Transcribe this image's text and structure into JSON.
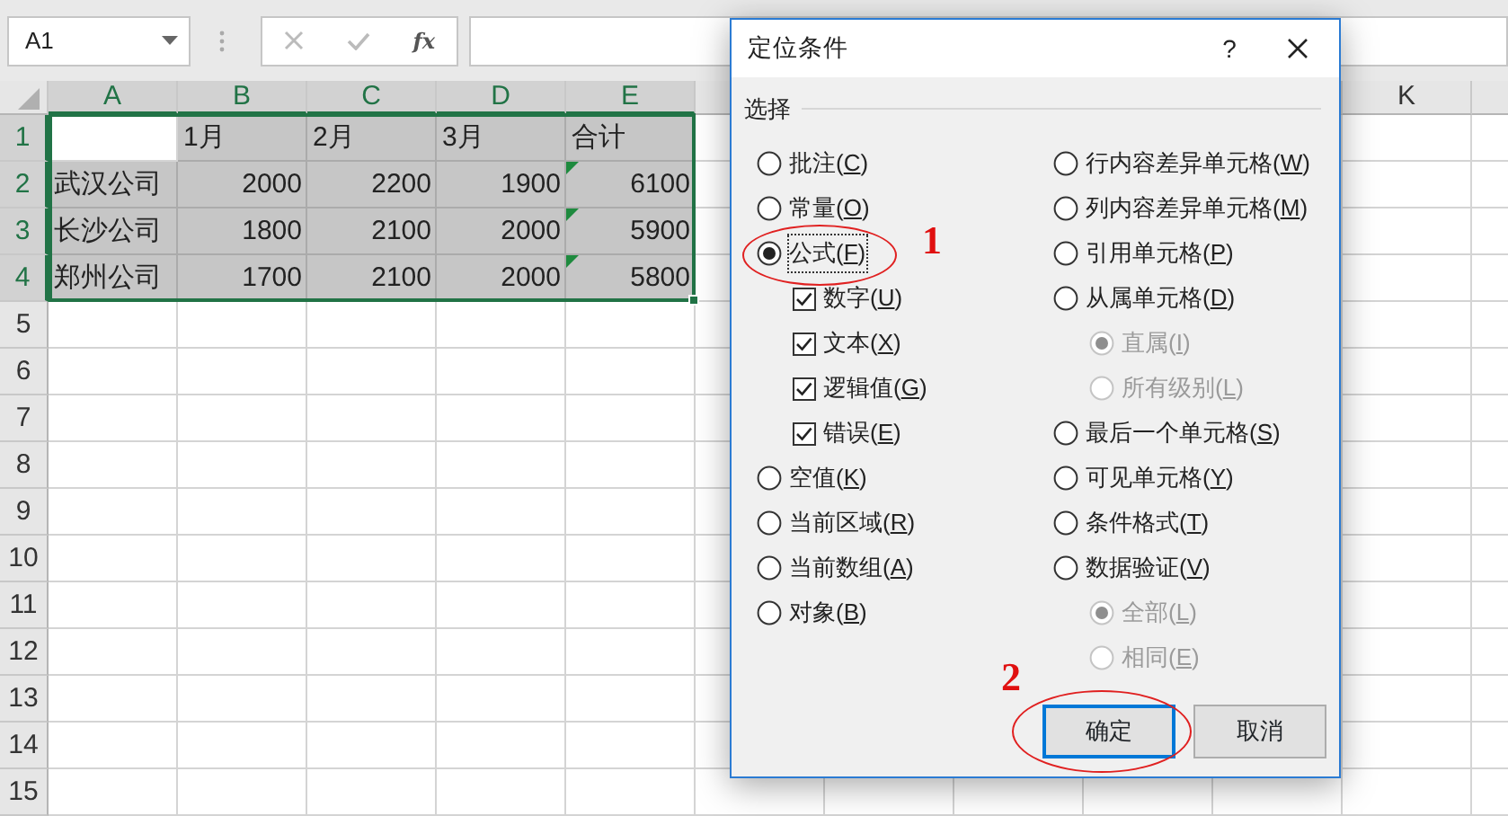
{
  "name_box": {
    "value": "A1"
  },
  "formula_bar": {
    "function_label": "fx"
  },
  "sheet": {
    "columns": [
      {
        "label": "A",
        "selected": true
      },
      {
        "label": "B",
        "selected": true
      },
      {
        "label": "C",
        "selected": true
      },
      {
        "label": "D",
        "selected": true
      },
      {
        "label": "E",
        "selected": true
      }
    ],
    "right_columns": [
      {
        "label": "K",
        "selected": false
      }
    ],
    "rows": [
      {
        "header": "1",
        "selected": true,
        "cells": [
          {
            "text": "",
            "selected": false
          },
          {
            "text": "1月",
            "selected": true
          },
          {
            "text": "2月",
            "selected": true
          },
          {
            "text": "3月",
            "selected": true
          },
          {
            "text": "合计",
            "selected": true
          }
        ]
      },
      {
        "header": "2",
        "selected": true,
        "cells": [
          {
            "text": "武汉公司",
            "selected": true
          },
          {
            "text": "2000",
            "selected": true
          },
          {
            "text": "2200",
            "selected": true
          },
          {
            "text": "1900",
            "selected": true
          },
          {
            "text": "6100",
            "selected": true,
            "flag": true
          }
        ]
      },
      {
        "header": "3",
        "selected": true,
        "cells": [
          {
            "text": "长沙公司",
            "selected": true
          },
          {
            "text": "1800",
            "selected": true
          },
          {
            "text": "2100",
            "selected": true
          },
          {
            "text": "2000",
            "selected": true
          },
          {
            "text": "5900",
            "selected": true,
            "flag": true
          }
        ]
      },
      {
        "header": "4",
        "selected": true,
        "cells": [
          {
            "text": "郑州公司",
            "selected": true
          },
          {
            "text": "1700",
            "selected": true
          },
          {
            "text": "2100",
            "selected": true
          },
          {
            "text": "2000",
            "selected": true
          },
          {
            "text": "5800",
            "selected": true,
            "flag": true
          }
        ]
      },
      {
        "header": "5",
        "selected": false,
        "cells": []
      },
      {
        "header": "6",
        "selected": false,
        "cells": []
      },
      {
        "header": "7",
        "selected": false,
        "cells": []
      },
      {
        "header": "8",
        "selected": false,
        "cells": []
      },
      {
        "header": "9",
        "selected": false,
        "cells": []
      },
      {
        "header": "10",
        "selected": false,
        "cells": []
      },
      {
        "header": "11",
        "selected": false,
        "cells": []
      },
      {
        "header": "12",
        "selected": false,
        "cells": []
      },
      {
        "header": "13",
        "selected": false,
        "cells": []
      },
      {
        "header": "14",
        "selected": false,
        "cells": []
      },
      {
        "header": "15",
        "selected": false,
        "cells": []
      }
    ]
  },
  "dialog": {
    "title": "定位条件",
    "help": "?",
    "group_label": "选择",
    "left_options": [
      {
        "kind": "radio",
        "label": "批注(C)",
        "selected": false,
        "disabled": false
      },
      {
        "kind": "radio",
        "label": "常量(O)",
        "selected": false,
        "disabled": false
      },
      {
        "kind": "radio",
        "label": "公式(F)",
        "selected": true,
        "disabled": false,
        "annotation": "1",
        "children": [
          {
            "kind": "checkbox",
            "label": "数字(U)",
            "checked": true,
            "disabled": false
          },
          {
            "kind": "checkbox",
            "label": "文本(X)",
            "checked": true,
            "disabled": false
          },
          {
            "kind": "checkbox",
            "label": "逻辑值(G)",
            "checked": true,
            "disabled": false
          },
          {
            "kind": "checkbox",
            "label": "错误(E)",
            "checked": true,
            "disabled": false
          }
        ]
      },
      {
        "kind": "radio",
        "label": "空值(K)",
        "selected": false,
        "disabled": false
      },
      {
        "kind": "radio",
        "label": "当前区域(R)",
        "selected": false,
        "disabled": false
      },
      {
        "kind": "radio",
        "label": "当前数组(A)",
        "selected": false,
        "disabled": false
      },
      {
        "kind": "radio",
        "label": "对象(B)",
        "selected": false,
        "disabled": false
      }
    ],
    "right_options": [
      {
        "kind": "radio",
        "label": "行内容差异单元格(W)",
        "selected": false,
        "disabled": false
      },
      {
        "kind": "radio",
        "label": "列内容差异单元格(M)",
        "selected": false,
        "disabled": false
      },
      {
        "kind": "radio",
        "label": "引用单元格(P)",
        "selected": false,
        "disabled": false
      },
      {
        "kind": "radio",
        "label": "从属单元格(D)",
        "selected": false,
        "disabled": false,
        "children": [
          {
            "kind": "radio",
            "label": "直属(I)",
            "selected": true,
            "disabled": true
          },
          {
            "kind": "radio",
            "label": "所有级别(L)",
            "selected": false,
            "disabled": true
          }
        ]
      },
      {
        "kind": "radio",
        "label": "最后一个单元格(S)",
        "selected": false,
        "disabled": false
      },
      {
        "kind": "radio",
        "label": "可见单元格(Y)",
        "selected": false,
        "disabled": false
      },
      {
        "kind": "radio",
        "label": "条件格式(T)",
        "selected": false,
        "disabled": false
      },
      {
        "kind": "radio",
        "label": "数据验证(V)",
        "selected": false,
        "disabled": false,
        "children": [
          {
            "kind": "radio",
            "label": "全部(L)",
            "selected": true,
            "disabled": true
          },
          {
            "kind": "radio",
            "label": "相同(E)",
            "selected": false,
            "disabled": true
          }
        ]
      }
    ],
    "buttons": [
      {
        "label": "确定",
        "default": true,
        "annotation": "2"
      },
      {
        "label": "取消",
        "default": false
      }
    ]
  }
}
